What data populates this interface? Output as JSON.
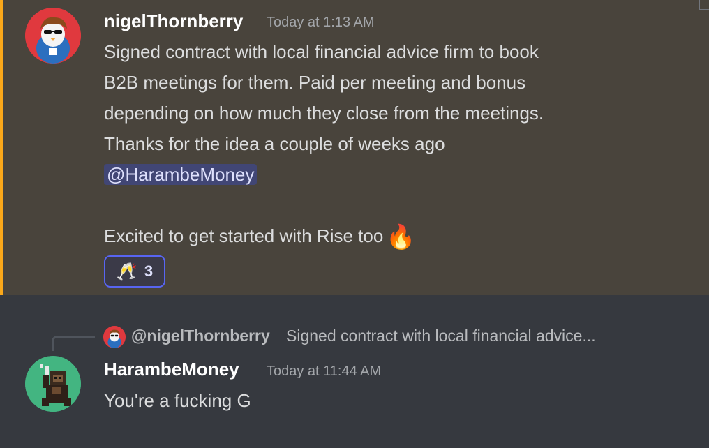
{
  "message1": {
    "username": "nigelThornberry",
    "timestamp": "Today at 1:13 AM",
    "lines": [
      "Signed contract with local financial advice firm to book",
      "B2B meetings for them. Paid per meeting and bonus",
      "depending on how much they close from the meetings.",
      "Thanks for the idea a couple of weeks ago"
    ],
    "mention": "@HarambeMoney",
    "closing_line": "Excited to get started with Rise too",
    "closing_emoji": "🔥",
    "reaction": {
      "emoji": "🥂",
      "count": "3"
    },
    "avatar_icon": "penguin-avatar-icon"
  },
  "message2": {
    "reply": {
      "username": "@nigelThornberry",
      "preview": "Signed contract with local financial advice..."
    },
    "username": "HarambeMoney",
    "timestamp": "Today at 11:44 AM",
    "text": "You're a fucking G",
    "avatar_icon": "pixel-ape-avatar-icon"
  },
  "colors": {
    "highlight_bg": "#49443c",
    "highlight_bar": "#faa81a",
    "background": "#36393f",
    "mention_bg": "#414675",
    "reaction_border": "#5865f2"
  }
}
